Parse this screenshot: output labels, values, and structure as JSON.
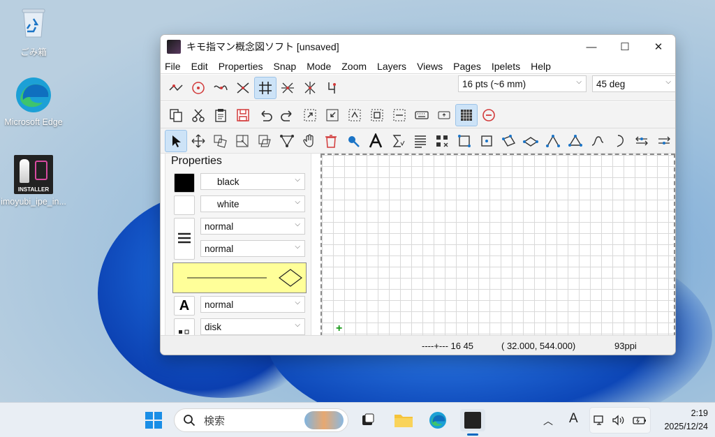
{
  "desktop": {
    "icons": [
      {
        "label": "ごみ箱",
        "icon": "recycle-bin-icon"
      },
      {
        "label": "Microsoft Edge",
        "icon": "edge-icon"
      },
      {
        "label": "imoyubi_ipe_in...",
        "icon": "installer-icon",
        "badge": "INSTALLER"
      }
    ]
  },
  "window": {
    "title": "キモ指マン概念図ソフト [unsaved]",
    "controls": {
      "minimize": "—",
      "maximize": "☐",
      "close": "✕"
    },
    "menu": [
      "File",
      "Edit",
      "Properties",
      "Snap",
      "Mode",
      "Zoom",
      "Layers",
      "Views",
      "Pages",
      "Ipelets",
      "Help"
    ],
    "snap_size": "16 pts (~6 mm)",
    "snap_angle": "45 deg",
    "properties": {
      "title": "Properties",
      "stroke": "black",
      "fill": "white",
      "pen": "normal",
      "dash": "normal",
      "text_size": "normal",
      "mark": "disk"
    },
    "status": {
      "snap": "----+--- 16 45",
      "coords": "( 32.000, 544.000)",
      "resolution": "93ppi"
    }
  },
  "taskbar": {
    "search_placeholder": "検索",
    "time": "2:19",
    "date": "2025/12/24",
    "ime": "A"
  },
  "colors": {
    "accent": "#0067c0",
    "stroke": "#000000",
    "fill": "#ffffff",
    "preview_bg": "#ffff99",
    "icon_blue": "#1b74c6",
    "icon_red": "#d23a3a"
  }
}
